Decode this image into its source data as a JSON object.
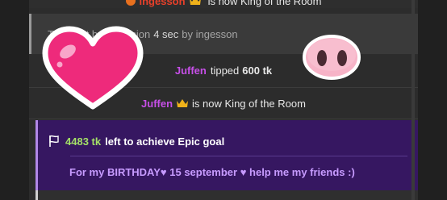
{
  "messages": {
    "king_prev": {
      "user": "ingesson",
      "text": "is now King of the Room"
    },
    "topic": {
      "text_prefix": "Topic set by a session",
      "time": "4 sec",
      "by_label": "by ingesson"
    },
    "tip": {
      "user": "Juffen",
      "text": "tipped",
      "amount": "600 tk"
    },
    "king": {
      "user": "Juffen",
      "text": "is now King of the Room"
    }
  },
  "goal": {
    "amount": "4483 tk",
    "text": "left to achieve Epic goal",
    "description": "For my BIRTHDAY♥ 15 september ♥ help me my friends :)"
  },
  "colors": {
    "background": "#202020",
    "chat_bg": "#2c2c2c",
    "goal_bg": "#361761",
    "user_purple": "#c64fe7",
    "goal_amount": "#a4e067",
    "goal_text": "#c79bff",
    "heart": "#ee2a7b",
    "pig": "#f7b3c7"
  }
}
